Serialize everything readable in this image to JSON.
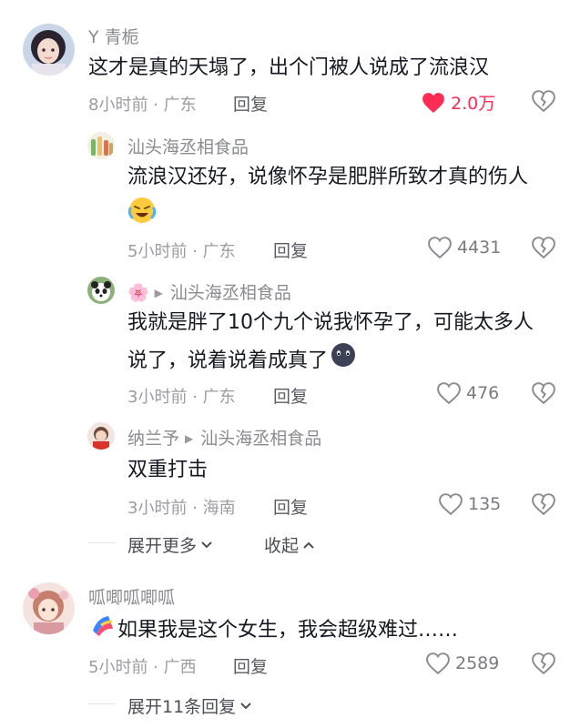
{
  "comments": [
    {
      "username": "Y 青栀",
      "text": "这才是真的天塌了，出个门被人说成了流浪汉",
      "time_location": "8小时前 · 广东",
      "reply_label": "回复",
      "likes": "2.0万",
      "liked": true
    },
    {
      "username": "汕头海丞相食品",
      "text": "流浪汉还好，说像怀孕是肥胖所致才真的伤人",
      "emoji": "laughing-crying-emoji",
      "time_location": "5小时前 · 广东",
      "reply_label": "回复",
      "likes": "4431"
    },
    {
      "username": "🌸",
      "reply_to": "汕头海丞相食品",
      "text_line1": "我就是胖了10个九个说我怀孕了，可能太多人",
      "text_line2": "说了，说着说着成真了",
      "emoji": "sad-face-emoji",
      "time_location": "3小时前 · 广东",
      "reply_label": "回复",
      "likes": "476"
    },
    {
      "username": "纳兰予",
      "reply_to": "汕头海丞相食品",
      "text": "双重打击",
      "time_location": "3小时前 · 海南",
      "reply_label": "回复",
      "likes": "135"
    },
    {
      "username": "呱唧呱唧呱",
      "text": "如果我是这个女生，我会超级难过……",
      "emoji": "flag-emoji",
      "time_location": "5小时前 · 广西",
      "reply_label": "回复",
      "likes": "2589"
    }
  ],
  "thread_controls": {
    "expand_more": "展开更多",
    "collapse": "收起",
    "expand_replies": "展开11条回复"
  },
  "colors": {
    "liked": "#fe2c55",
    "text": "#161823",
    "meta": "#9b9ca2"
  }
}
